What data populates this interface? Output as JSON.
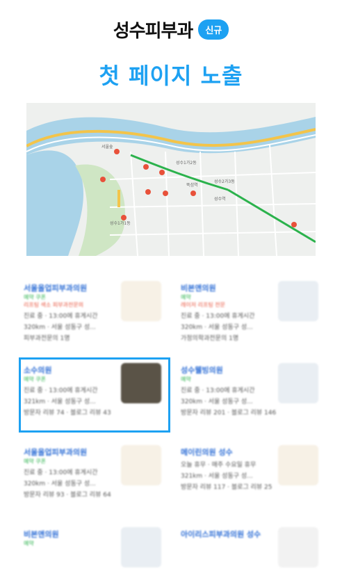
{
  "header": {
    "title": "성수피부과",
    "badge": "신규"
  },
  "headline": "첫 페이지 노출",
  "map": {
    "labels": [
      "서울숲",
      "성수1가2동",
      "성수2가3동",
      "성수1가1동",
      "뚝섬역",
      "성수역"
    ]
  },
  "results": [
    {
      "name": "서울올업피부과의원",
      "tags": "예약 쿠폰",
      "promo": "리프팅 색소 피부과전문의",
      "l1": "진료 중 · 13:00에 휴게시간",
      "l2": "320km · 서울 성동구 성...",
      "l3": "피부과전문의 1명"
    },
    {
      "name": "비본앤의원",
      "tags": "예약",
      "promo": "레이저 리프팅 전문",
      "l1": "진료 중 · 13:00에 휴게시간",
      "l2": "320km · 서울 성동구 성...",
      "l3": "가정의학과전문의 1명"
    },
    {
      "name": "소수의원",
      "tags": "예약 쿠폰",
      "promo": "",
      "l1": "진료 중 · 13:00에 휴게시간",
      "l2": "321km · 서울 성동구 성...",
      "l3": "방문자 리뷰 74 · 블로그 리뷰 43"
    },
    {
      "name": "성수웰빙의원",
      "tags": "예약",
      "promo": "",
      "l1": "진료 중 · 13:00에 휴게시간",
      "l2": "320km · 서울 성동구 성...",
      "l3": "방문자 리뷰 201 · 블로그 리뷰 146"
    },
    {
      "name": "서울올업피부과의원",
      "tags": "예약 쿠폰",
      "promo": "",
      "l1": "진료 중 · 13:00에 휴게시간",
      "l2": "320km · 서울 성동구 성...",
      "l3": "방문자 리뷰 93 · 블로그 리뷰 64"
    },
    {
      "name": "메이린의원 성수",
      "tags": "",
      "promo": "",
      "l1": "오늘 휴무 · 매주 수요일 휴무",
      "l2": "321km · 서울 성동구 성...",
      "l3": "방문자 리뷰 117 · 블로그 리뷰 25"
    },
    {
      "name": "비본앤의원",
      "tags": "예약",
      "promo": "",
      "l1": "",
      "l2": "",
      "l3": ""
    },
    {
      "name": "아이리스피부과의원 성수",
      "tags": "",
      "promo": "",
      "l1": "",
      "l2": "",
      "l3": ""
    }
  ]
}
